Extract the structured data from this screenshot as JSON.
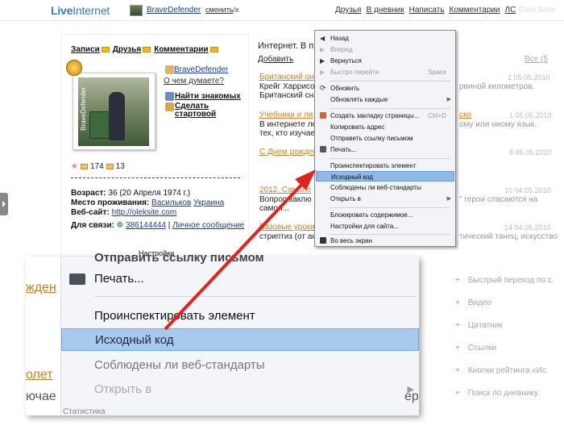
{
  "header": {
    "logo_part1": "Live",
    "logo_part2": "Internet",
    "username": "BraveDefender",
    "change_label": "сменить",
    "change_suffix": "/x",
    "nav": [
      "Друзья",
      "В дневник",
      "Написать",
      "Комментарии",
      "ЛС"
    ],
    "right_faded": "Cool Бесп"
  },
  "profile": {
    "tabs": [
      "Записи",
      "Друзья",
      "Комментарии"
    ],
    "photo_caption": "BraveDefender",
    "username": "BraveDefender",
    "status_prompt": "О чем думаете?",
    "find_friends": "Найти знакомых",
    "make_home": "Сделать стартовой",
    "stat_a": "174",
    "stat_b": "13",
    "age_label": "Возраст:",
    "age_value": "36 (20 Апреля 1974 г.)",
    "location_label": "Место проживания:",
    "location_city": "Васильков",
    "location_country": "Украина",
    "site_label": "Веб-сайт:",
    "site_value": "http://oleksite.com",
    "contact_label": "Для связи:",
    "contact_icq": "386144444",
    "contact_sep": "|",
    "contact_pm": "Личное сообщение",
    "settings": "Настройки"
  },
  "feed": {
    "title": "Интернет. В п",
    "add": "Добавить",
    "all": "Все (5",
    "items": [
      {
        "title": "Британский он",
        "text1": "Крейг Харрисон с",
        "text2": "Британский снай",
        "right": "рвиной километров.",
        "date": "2 05.05.2010"
      },
      {
        "title": "Учебники и ли",
        "text1": "В интернете леги",
        "text2": "тех, кто изучает",
        "right": "ому или ниому язык.",
        "right_title": "ско",
        "date": "1 05.05.2010"
      },
      {
        "title": "С Днем рожден",
        "date": "8 05.05.2010"
      },
      {
        "title": "2012. Самоле",
        "text1": "Вопрос заклю",
        "text2": "самол...",
        "right": "\" герои спасаются на",
        "date": "10 04.05.2010"
      },
      {
        "title": "Базовые уроки",
        "text1": "стриптиз (от ан",
        "right": "тический танец, искусство",
        "date": "14 04.05.2010"
      }
    ]
  },
  "context_menu": {
    "items": [
      {
        "label": "Назад",
        "enabled": true
      },
      {
        "label": "Вперед",
        "enabled": false
      },
      {
        "label": "Вернуться",
        "enabled": true
      },
      {
        "label": "Быстро перейти",
        "enabled": false,
        "shortcut": "Space"
      },
      {
        "label": "Обновить",
        "enabled": true
      },
      {
        "label": "Обновлять каждые",
        "enabled": true,
        "submenu": true
      },
      {
        "label": "Создать закладку страницы...",
        "enabled": true,
        "shortcut": "Ctrl+D"
      },
      {
        "label": "Копировать адрес",
        "enabled": true
      },
      {
        "label": "Отправить ссылку письмом",
        "enabled": true
      },
      {
        "label": "Печать...",
        "enabled": true
      },
      {
        "label": "Проинспектировать элемент",
        "enabled": true
      },
      {
        "label": "Исходный код",
        "enabled": true,
        "highlighted": true
      },
      {
        "label": "Соблюдены ли веб-стандарты",
        "enabled": true
      },
      {
        "label": "Открыть в",
        "enabled": true,
        "submenu": true
      },
      {
        "label": "Блокировать содержимое...",
        "enabled": true
      },
      {
        "label": "Настройки для сайта...",
        "enabled": true
      },
      {
        "label": "Во весь экран",
        "enabled": true
      }
    ]
  },
  "zoom": {
    "left_fragments": [
      "жден",
      "олет",
      "ючае"
    ],
    "partial_top": "Отправить ссылку письмом",
    "print": "Печать...",
    "inspect": "Проинспектировать элемент",
    "source": "Исходный код",
    "standards": "Соблюдены ли веб-стандарты",
    "open_in": "Открыть в",
    "bottom_left": "Статистика",
    "right_fragment": "ер"
  },
  "sidebar_faded": [
    "Быстрый переход по с",
    "Видео",
    "Цитатник",
    "Ссылки",
    "Кнопки рейтинга «Ис",
    "Поиск по дневнику"
  ],
  "colors": {
    "highlight": "#8fb8e6",
    "arrow": "#e0231c",
    "link": "#1a3d9c"
  }
}
